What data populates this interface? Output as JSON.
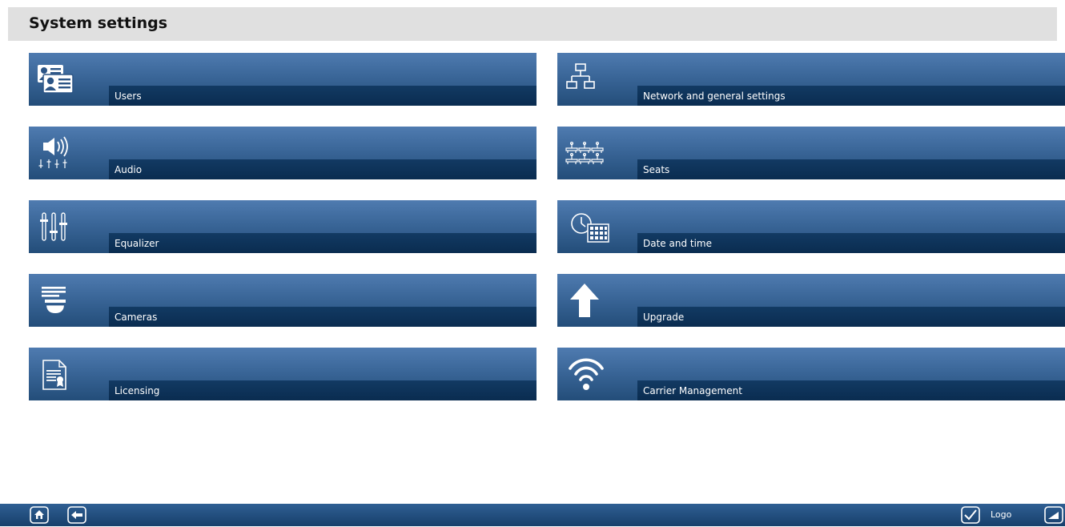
{
  "header": {
    "title": "System settings"
  },
  "tiles": {
    "users": {
      "label": "Users",
      "icon": "users-card-icon"
    },
    "network": {
      "label": "Network and general settings",
      "icon": "network-icon"
    },
    "audio": {
      "label": "Audio",
      "icon": "audio-icon"
    },
    "seats": {
      "label": "Seats",
      "icon": "seats-icon"
    },
    "equalizer": {
      "label": "Equalizer",
      "icon": "equalizer-icon"
    },
    "datetime": {
      "label": "Date and time",
      "icon": "clock-calendar-icon"
    },
    "cameras": {
      "label": "Cameras",
      "icon": "dome-camera-icon"
    },
    "upgrade": {
      "label": "Upgrade",
      "icon": "upload-arrow-icon"
    },
    "licensing": {
      "label": "Licensing",
      "icon": "license-document-icon"
    },
    "carrier": {
      "label": "Carrier Management",
      "icon": "wifi-icon"
    }
  },
  "footer": {
    "logo_label": "Logo",
    "buttons": [
      "home-icon",
      "back-icon",
      "check-icon",
      "expand-icon"
    ]
  },
  "colors": {
    "header_bg": "#e0e0e0",
    "tile_top": "#4f7bb0",
    "tile_bottom": "#234d79",
    "label_band": "#0a2c50",
    "footer": "#173f6b"
  }
}
